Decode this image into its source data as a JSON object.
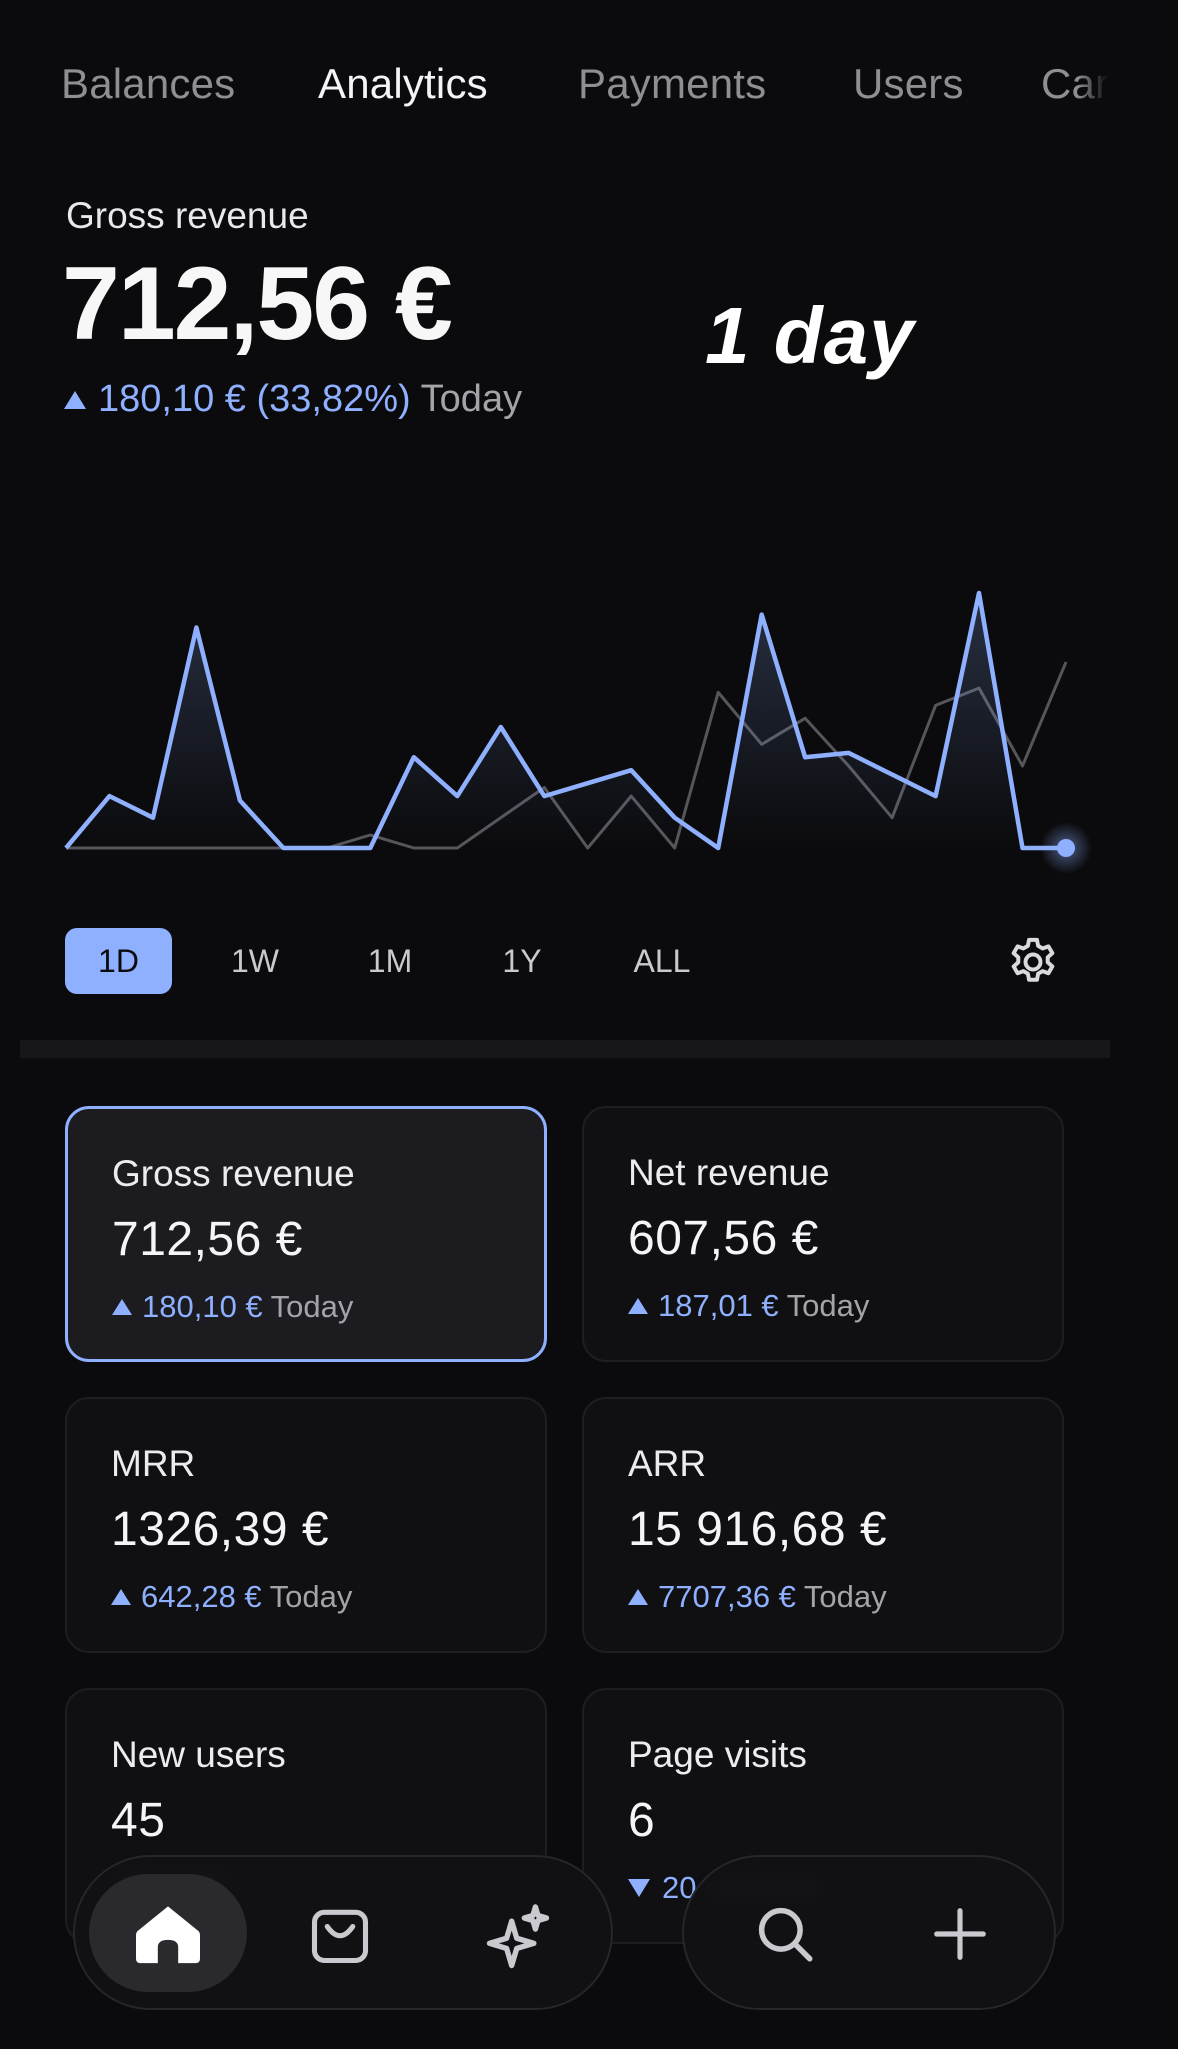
{
  "tabs": [
    {
      "label": "Balances",
      "active": false
    },
    {
      "label": "Analytics",
      "active": true
    },
    {
      "label": "Payments",
      "active": false
    },
    {
      "label": "Users",
      "active": false
    },
    {
      "label": "Car",
      "active": false
    }
  ],
  "header": {
    "label": "Gross revenue",
    "value": "712,56 €",
    "change": "180,10 € (33,82%)",
    "change_period": "Today",
    "direction": "up"
  },
  "overlay_text": "1 day",
  "chart_data": {
    "type": "area",
    "series": [
      {
        "values": [
          0,
          12,
          7,
          51,
          11,
          0,
          0,
          0,
          21,
          12,
          28,
          12,
          15,
          18,
          7,
          0,
          54,
          21,
          22,
          17,
          12,
          59,
          0,
          0
        ]
      },
      {
        "values": [
          0,
          0,
          0,
          0,
          0,
          0,
          0,
          3,
          0,
          0,
          7,
          14,
          0,
          12,
          0,
          36,
          24,
          30,
          19,
          7,
          33,
          37,
          19,
          43
        ]
      }
    ],
    "ylim": [
      0,
      62
    ],
    "grid": false
  },
  "ranges": [
    {
      "label": "1D",
      "active": true
    },
    {
      "label": "1W",
      "active": false
    },
    {
      "label": "1M",
      "active": false
    },
    {
      "label": "1Y",
      "active": false
    },
    {
      "label": "ALL",
      "active": false
    }
  ],
  "icons": {
    "settings": "gear-icon",
    "home": "home-icon",
    "shop": "shopping-bag-icon",
    "ai": "sparkles-icon",
    "search": "search-icon",
    "add": "plus-icon"
  },
  "colors": {
    "accent": "#8fb0ff",
    "background": "#0b0b0d",
    "secondary_line": "#55555c"
  },
  "cards": [
    {
      "title": "Gross revenue",
      "value": "712,56 €",
      "change": "180,10 €",
      "period": "Today",
      "direction": "up",
      "selected": true
    },
    {
      "title": "Net revenue",
      "value": "607,56 €",
      "change": "187,01 €",
      "period": "Today",
      "direction": "up",
      "selected": false
    },
    {
      "title": "MRR",
      "value": "1326,39 €",
      "change": "642,28 €",
      "period": "Today",
      "direction": "up",
      "selected": false
    },
    {
      "title": "ARR",
      "value": "15 916,68 €",
      "change": "7707,36 €",
      "period": "Today",
      "direction": "up",
      "selected": false
    },
    {
      "title": "New users",
      "value": "45",
      "change": "",
      "period": "",
      "direction": "up",
      "selected": false
    },
    {
      "title": "Page visits",
      "value": "6",
      "change": "20",
      "period": "",
      "direction": "down",
      "selected": false
    }
  ]
}
